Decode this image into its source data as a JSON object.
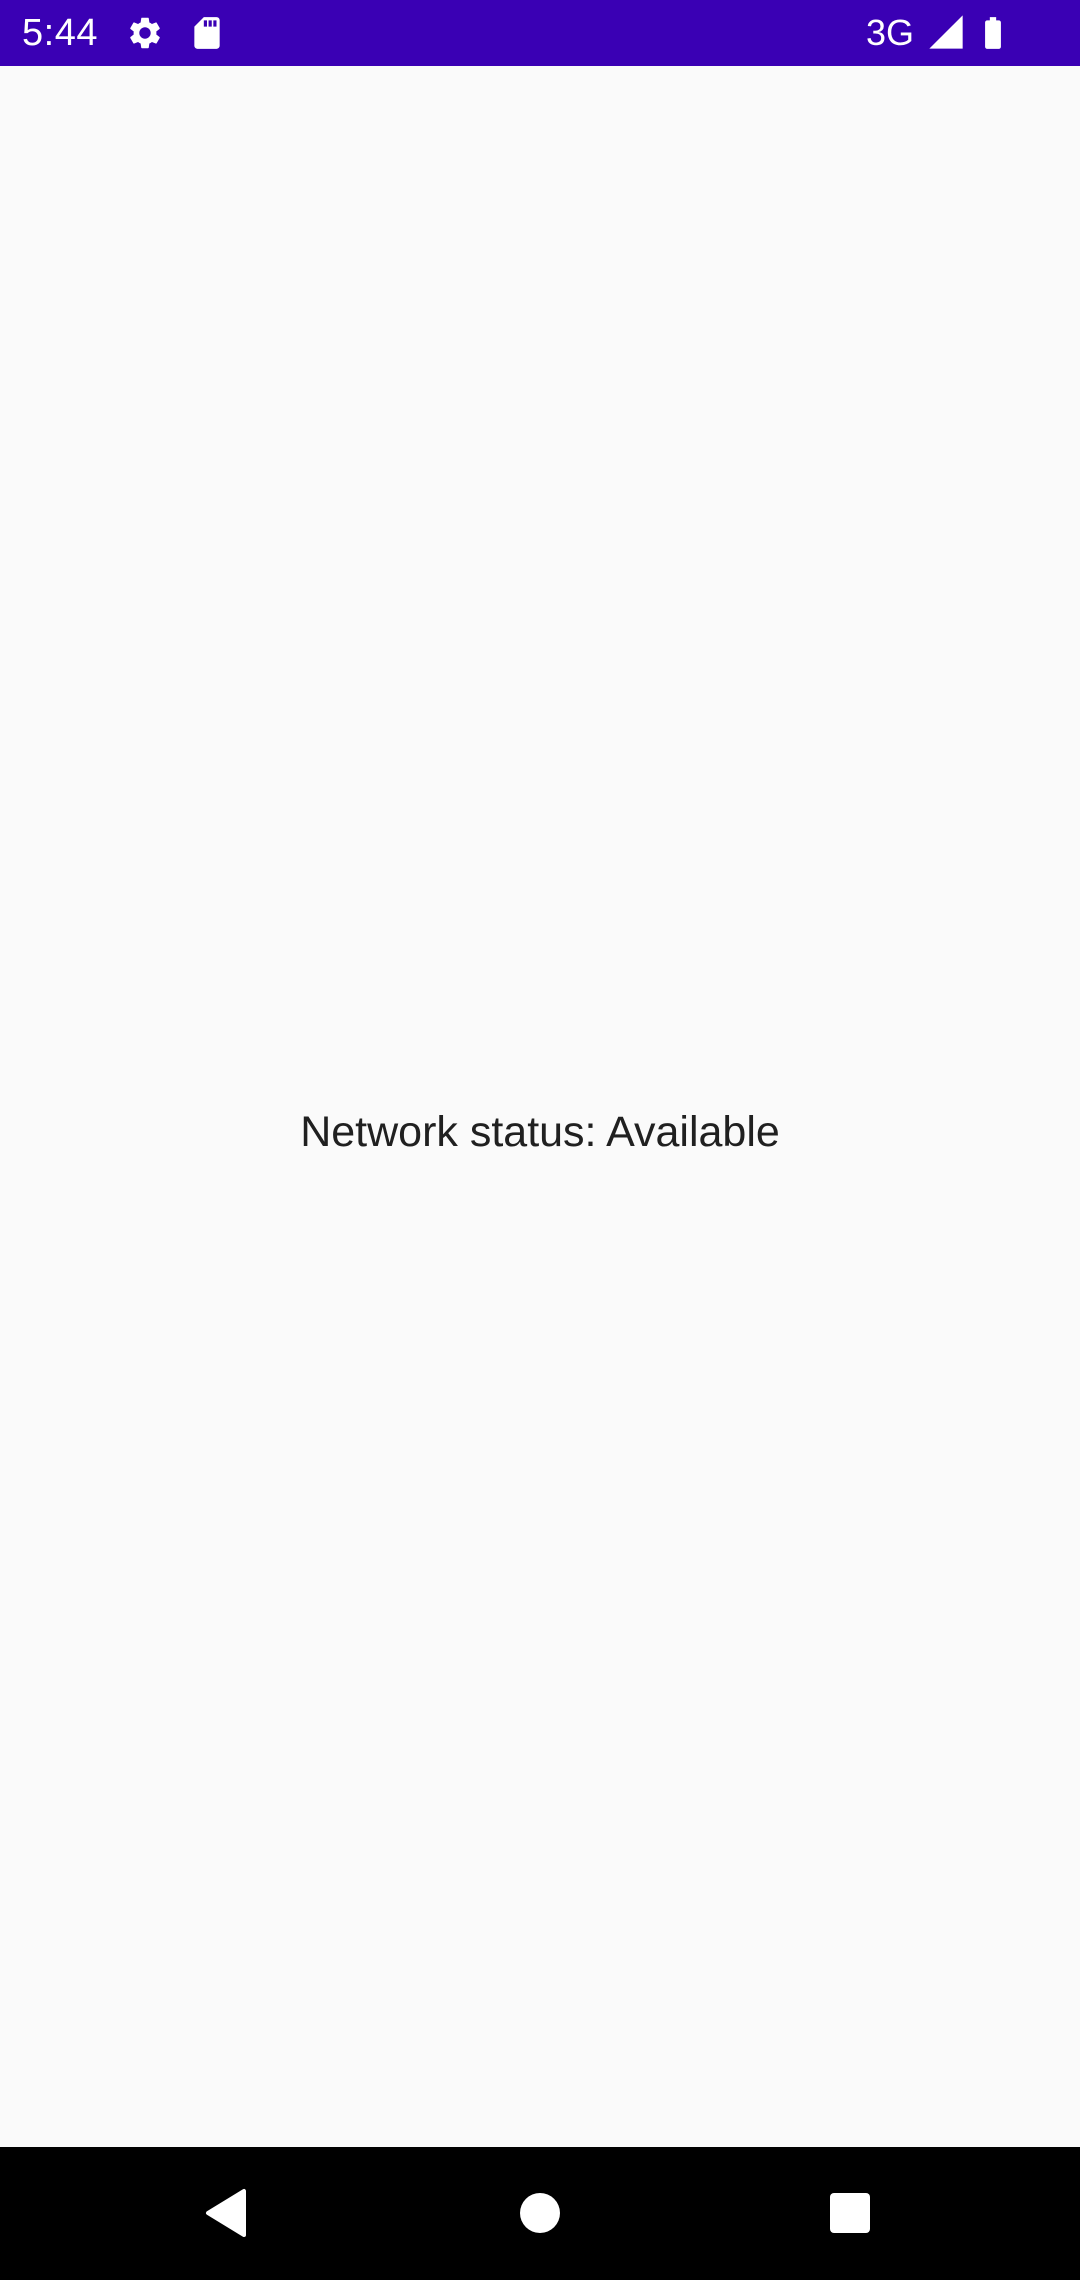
{
  "status_bar": {
    "time": "5:44",
    "network_type": "3G",
    "background_color": "#3a00b4",
    "icons": [
      "settings-gear-icon",
      "sd-card-icon",
      "signal-icon",
      "battery-icon"
    ]
  },
  "main": {
    "network_status_text": "Network status: Available"
  },
  "nav_bar": {
    "buttons": [
      "back-icon",
      "home-icon",
      "recents-icon"
    ]
  }
}
